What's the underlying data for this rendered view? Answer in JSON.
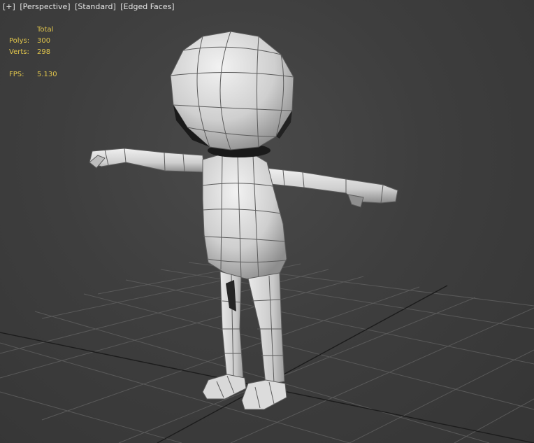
{
  "viewport_labels": {
    "menu": "[+]",
    "view": "[Perspective]",
    "shading": "[Standard]",
    "display": "[Edged Faces]"
  },
  "stats": {
    "header": "Total",
    "polys_label": "Polys:",
    "polys_value": "300",
    "verts_label": "Verts:",
    "verts_value": "298",
    "fps_label": "FPS:",
    "fps_value": "5.130"
  },
  "colors": {
    "background": "#3e3e3e",
    "grid": "#5a5a5a",
    "grid_main_axis": "#1e1e1e",
    "stats_text": "#e3c74c",
    "model_fill": "#d6d6d6",
    "model_edges": "#5c5c5c"
  }
}
